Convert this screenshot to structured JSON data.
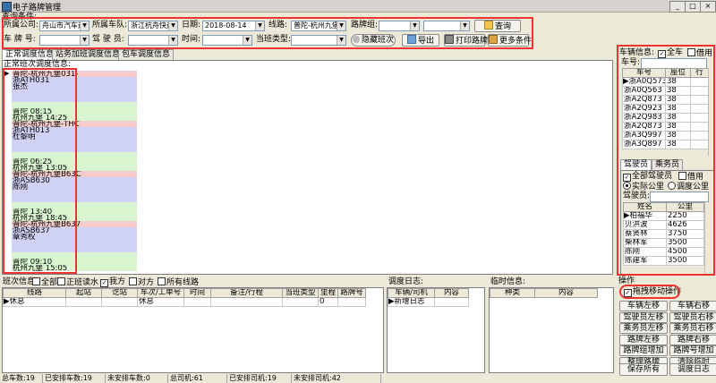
{
  "window": {
    "title": "电子路牌管理",
    "min": "_",
    "max": "□",
    "close": "×"
  },
  "query": {
    "group_label": "查询条件:",
    "company_label": "所属公司:",
    "company_value": "舟山市汽车运",
    "fleet_label": "所属车队:",
    "fleet_value": "浙江杭舟快运",
    "date_label": "日期:",
    "date_value": "2018-08-14",
    "route_label": "线路:",
    "route_value": "普陀-杭州九堡",
    "signgroup_label": "路牌组:",
    "signgroup_value": "",
    "plate_label": "车 牌 号:",
    "plate_value": "",
    "driver_label": "驾 驶 员:",
    "driver_value": "",
    "time_label": "时间:",
    "time_value": "",
    "shift_type_label": "当班类型:",
    "shift_type_value": "",
    "search_btn": "查询",
    "hide_shift_btn": "隐藏班次",
    "export_btn": "导出",
    "print_btn": "打印路牌",
    "more_btn": "更多条件"
  },
  "tabs": [
    "正常调度信息",
    "站务加班调度信息",
    "包车调度信息"
  ],
  "schedule": {
    "title": "正常班次调度信息:",
    "rows": [
      {
        "t": "普陀-杭州九堡031-",
        "c": "p",
        "arrow": true
      },
      {
        "t": "浙ATH031",
        "c": "v"
      },
      {
        "t": "张杰",
        "c": "v"
      },
      {
        "t": "",
        "c": "v"
      },
      {
        "t": "",
        "c": "v"
      },
      {
        "t": "",
        "c": "g"
      },
      {
        "t": "普陀 08:15",
        "c": "g"
      },
      {
        "t": "杭州九堡 14:25",
        "c": "g"
      },
      {
        "t": "普陀-杭州九堡-THC",
        "c": "p"
      },
      {
        "t": "浙ATH013",
        "c": "v"
      },
      {
        "t": "杜黎明",
        "c": "v"
      },
      {
        "t": "",
        "c": "v"
      },
      {
        "t": "",
        "c": "v"
      },
      {
        "t": "",
        "c": "g"
      },
      {
        "t": "普陀 06:25",
        "c": "g"
      },
      {
        "t": "杭州九堡 13:05",
        "c": "g"
      },
      {
        "t": "普陀-杭州九堡B63C",
        "c": "p"
      },
      {
        "t": "浙ASB630",
        "c": "v"
      },
      {
        "t": "陈刚",
        "c": "v"
      },
      {
        "t": "",
        "c": "v"
      },
      {
        "t": "",
        "c": "v"
      },
      {
        "t": "",
        "c": "g"
      },
      {
        "t": "普陀 13:40",
        "c": "g"
      },
      {
        "t": "杭州九堡 18:45",
        "c": "g"
      },
      {
        "t": "普陀-杭州九堡B637",
        "c": "p"
      },
      {
        "t": "浙ASB637",
        "c": "v"
      },
      {
        "t": "章秀权",
        "c": "v"
      },
      {
        "t": "",
        "c": "v"
      },
      {
        "t": "",
        "c": "v"
      },
      {
        "t": "",
        "c": "g"
      },
      {
        "t": "普陀 09:10",
        "c": "g"
      },
      {
        "t": "杭州九堡 15:05",
        "c": "g"
      }
    ]
  },
  "shift_info": {
    "title": "班次信息",
    "all": "全部",
    "today_flow": "正班读水",
    "mine": "我方",
    "other": "对方",
    "all_routes": "所有线路",
    "columns": [
      "线路",
      "起站",
      "讫站",
      "车次/工单号",
      "时间",
      "备注/行程",
      "当班类型",
      "里程",
      "路牌号"
    ],
    "rows": [
      [
        "休息",
        "",
        "",
        "休息",
        "",
        "",
        "",
        "0",
        ""
      ]
    ]
  },
  "dispatch_log": {
    "title": "调度日志:",
    "columns": [
      "车辆/司机",
      "内容"
    ],
    "rows": [
      [
        "新增日志",
        ""
      ]
    ]
  },
  "temp_info": {
    "title": "临时信息:",
    "columns": [
      "种类",
      "内容"
    ]
  },
  "vehicle": {
    "title": "车辆信息:",
    "all_vehicles": "全车",
    "borrow": "借用",
    "plate_label": "车号:",
    "columns": [
      "车号",
      "座位",
      "行"
    ],
    "rows": [
      [
        "浙A0Q573",
        "38",
        ""
      ],
      [
        "浙A0Q563",
        "38",
        ""
      ],
      [
        "浙A2Q873",
        "38",
        ""
      ],
      [
        "浙A2Q923",
        "38",
        ""
      ],
      [
        "浙A2Q983",
        "38",
        ""
      ],
      [
        "浙A2Q873",
        "38",
        ""
      ],
      [
        "浙A3Q997",
        "38",
        ""
      ],
      [
        "浙A3Q897",
        "38",
        ""
      ]
    ]
  },
  "staff": {
    "tabs": [
      "驾驶员",
      "乘务员"
    ],
    "all_drivers": "全部驾驶员",
    "borrow": "借用",
    "actual_km": "实际公里",
    "dispatch_km": "调度公里",
    "driver_label": "驾驶员:",
    "columns": [
      "姓名",
      "公里"
    ],
    "rows": [
      [
        "柏福华",
        "2250"
      ],
      [
        "贝洪波",
        "4626"
      ],
      [
        "蔡贤林",
        "3750"
      ],
      [
        "柴林军",
        "3500"
      ],
      [
        "陈刚",
        "4500"
      ],
      [
        "陈建军",
        "3500"
      ]
    ]
  },
  "operations": {
    "title": "操作",
    "drag_label": "拖拽移动操作",
    "buttons": [
      "车辆左移",
      "车辆右移",
      "驾驶员左移",
      "驾驶员右移",
      "乘务员左移",
      "乘务员右移",
      "路牌左移",
      "路牌右移",
      "路牌组增加",
      "路牌号增加",
      "整理路牌",
      "清除临时",
      "保存所有",
      "调度日志"
    ]
  },
  "status_bar": [
    "总车数:19",
    "已安排车数:19",
    "未安排车数:0",
    "总司机:61",
    "已安排司机:19",
    "未安排司机:42"
  ],
  "colors": {
    "highlight_red": "#ee3333",
    "green_row": "#d8f5cf",
    "pink_row": "#f4cccc",
    "violet_row": "#cfd1f5"
  }
}
